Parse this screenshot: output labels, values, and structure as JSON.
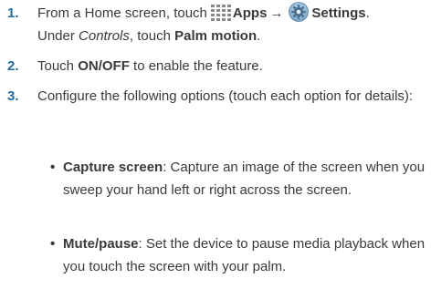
{
  "steps": [
    {
      "number": "1.",
      "intro": "From a Home screen, touch",
      "apps_label": "Apps",
      "arrow": "→",
      "settings_label": "Settings",
      "period": ".",
      "under": "Under ",
      "controls": "Controls",
      "touch": ", touch ",
      "palm_motion": "Palm motion",
      "end": "."
    },
    {
      "number": "2.",
      "pre": "Touch ",
      "onoff": "ON/OFF",
      "post": " to enable the feature."
    },
    {
      "number": "3.",
      "text": "Configure the following options (touch each option for details):"
    }
  ],
  "bullets": [
    {
      "dot": "•",
      "term": "Capture screen",
      "desc": ": Capture an image of the screen when you sweep your hand left or right across the screen."
    },
    {
      "dot": "•",
      "term": "Mute/pause",
      "desc": ": Set the device to pause media playback when you touch the screen with your palm."
    }
  ],
  "icons": {
    "apps": "apps-grid-icon",
    "settings": "settings-gear-icon"
  },
  "colors": {
    "step_number": "#1f6aa5",
    "text": "#3a3a3a"
  }
}
